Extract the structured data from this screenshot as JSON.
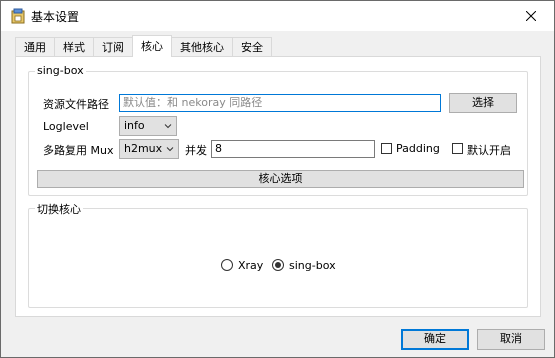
{
  "window": {
    "title": "基本设置"
  },
  "tabs": [
    {
      "label": "通用"
    },
    {
      "label": "样式"
    },
    {
      "label": "订阅"
    },
    {
      "label": "核心",
      "active": true
    },
    {
      "label": "其他核心"
    },
    {
      "label": "安全"
    }
  ],
  "singbox_group": {
    "title": "sing-box",
    "asset_path_label": "资源文件路径",
    "asset_path_placeholder": "默认值：和 nekoray 同路径",
    "select_button": "选择",
    "loglevel_label": "Loglevel",
    "loglevel_value": "info",
    "mux_label": "多路复用 Mux",
    "mux_protocol_value": "h2mux",
    "concurrency_label": "并发",
    "concurrency_value": "8",
    "padding_label": "Padding",
    "padding_checked": false,
    "default_on_label": "默认开启",
    "default_on_checked": false,
    "core_options_button": "核心选项"
  },
  "switch_core_group": {
    "title": "切换核心",
    "options": [
      {
        "label": "Xray",
        "checked": false
      },
      {
        "label": "sing-box",
        "checked": true
      }
    ]
  },
  "footer": {
    "ok_button": "确定",
    "cancel_button": "取消"
  },
  "colors": {
    "accent": "#0078d7",
    "panel_bg": "#ffffff",
    "window_bg": "#f0f0f0"
  }
}
